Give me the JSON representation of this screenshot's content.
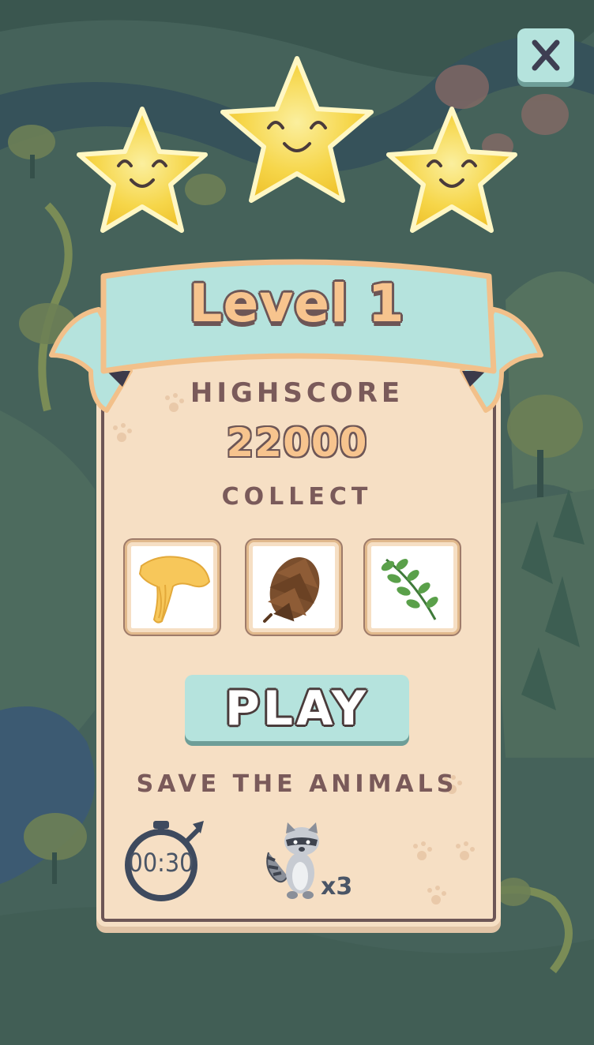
{
  "level": {
    "title": "Level 1",
    "stars_earned": 3,
    "stars_total": 3
  },
  "highscore": {
    "label": "HIGHSCORE",
    "value": "22000"
  },
  "collect": {
    "label": "COLLECT",
    "items": [
      {
        "icon": "chanterelle-mushroom-icon"
      },
      {
        "icon": "pine-cone-icon"
      },
      {
        "icon": "green-leaf-icon"
      }
    ]
  },
  "play_button": {
    "label": "PLAY"
  },
  "save": {
    "label": "SAVE THE ANIMALS",
    "timer": "00:30",
    "timer_icon": "stopwatch-icon",
    "animal_icon": "raccoon-icon",
    "animal_count": "x3"
  },
  "close_button": {
    "icon": "close-icon"
  },
  "colors": {
    "panel": "#f6dfc4",
    "panel_border": "#6d5656",
    "ribbon": "#b5e3dd",
    "ribbon_edge": "#f2c08a",
    "star": "#f6d64a",
    "button": "#b5e3dd",
    "label_text": "#7a5a5a"
  }
}
